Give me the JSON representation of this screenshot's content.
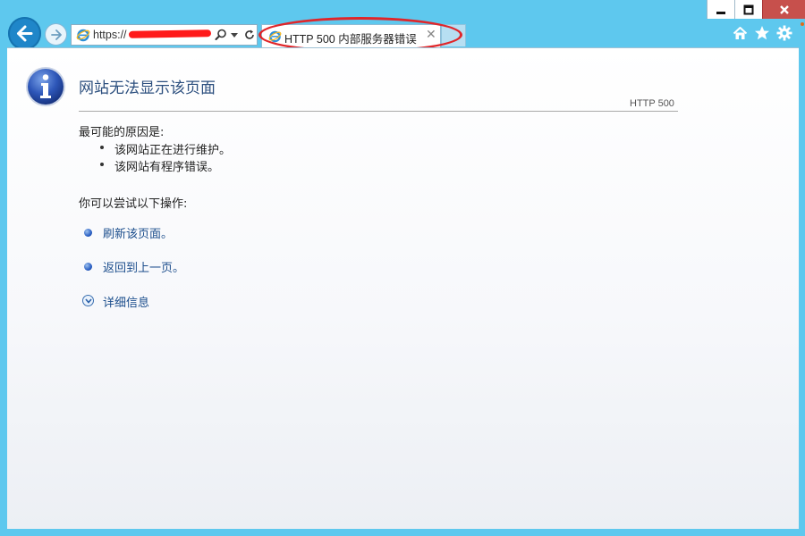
{
  "browser": {
    "address_url": "https://",
    "tab_title": "HTTP 500 内部服务器错误",
    "tab_close_glyph": "✕",
    "icons": {
      "back": "arrow-left-icon",
      "forward": "arrow-right-icon",
      "page": "ie-logo-icon",
      "search": "search-icon",
      "dropdown": "chevron-down-icon",
      "refresh": "refresh-icon",
      "home": "home-icon",
      "favorites": "star-icon",
      "tools": "gear-icon",
      "minimize": "minimize-icon",
      "maximize": "maximize-icon",
      "close": "close-icon"
    }
  },
  "error_page": {
    "heading": "网站无法显示该页面",
    "status_code": "HTTP 500",
    "reasons_title": "最可能的原因是:",
    "reasons": [
      "该网站正在进行维护。",
      "该网站有程序错误。"
    ],
    "actions_title": "你可以尝试以下操作:",
    "actions": [
      {
        "label": "刷新该页面。"
      },
      {
        "label": "返回到上一页。"
      }
    ],
    "more_info": "详细信息",
    "icon": "info-icon"
  },
  "colors": {
    "chrome": "#5ec8ee",
    "heading": "#2c4f7e",
    "link": "#1b4d8c",
    "highlight": "#e0262a",
    "close_button": "#c7504c"
  }
}
